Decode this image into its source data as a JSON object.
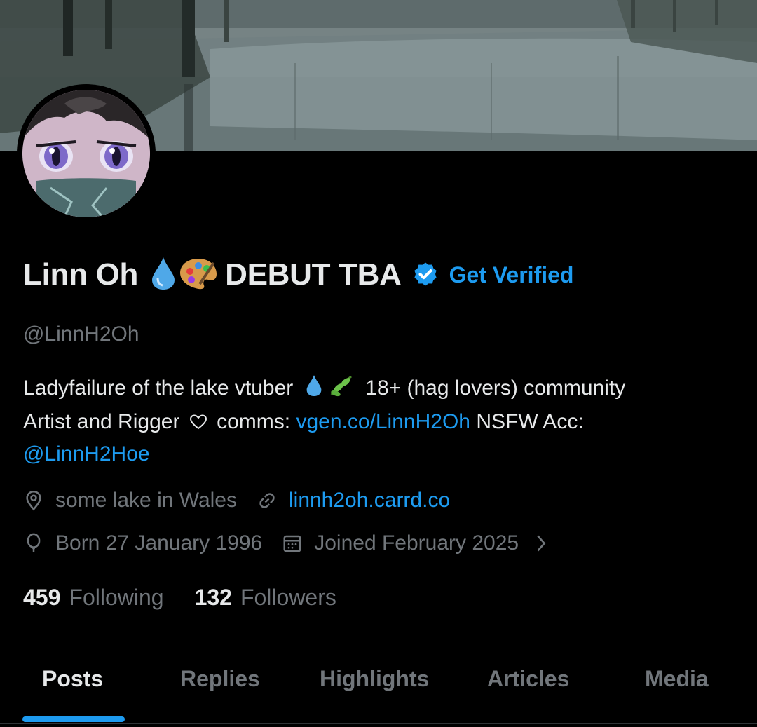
{
  "profile": {
    "display_name": "Linn Oh",
    "name_suffix": "DEBUT TBA",
    "get_verified_label": "Get Verified",
    "handle": "@LinnH2Oh",
    "bio": {
      "line1_text": "Ladyfailure of the lake vtuber",
      "line1_rest": "18+ (hag lovers) community",
      "line2_text": "Artist and Rigger",
      "line2_comms": "comms:",
      "line2_link": "vgen.co/LinnH2Oh",
      "line2_tail": "NSFW Acc:",
      "line3_mention": "@LinnH2Hoe"
    },
    "location": "some lake in Wales",
    "website": "linnh2oh.carrd.co",
    "birthday": "Born 27 January 1996",
    "joined": "Joined February 2025",
    "following_count": "459",
    "following_label": "Following",
    "followers_count": "132",
    "followers_label": "Followers"
  },
  "tabs": [
    {
      "label": "Posts",
      "active": true
    },
    {
      "label": "Replies"
    },
    {
      "label": "Highlights"
    },
    {
      "label": "Articles"
    },
    {
      "label": "Media"
    }
  ],
  "colors": {
    "accent": "#1d9bf0",
    "background": "#000000",
    "text_primary": "#e7e9ea",
    "text_secondary": "#71767b"
  },
  "icons": {
    "location": "map-pin-icon",
    "website": "link-icon",
    "birthday": "balloon-icon",
    "joined": "calendar-icon",
    "verified": "verified-badge-icon"
  }
}
